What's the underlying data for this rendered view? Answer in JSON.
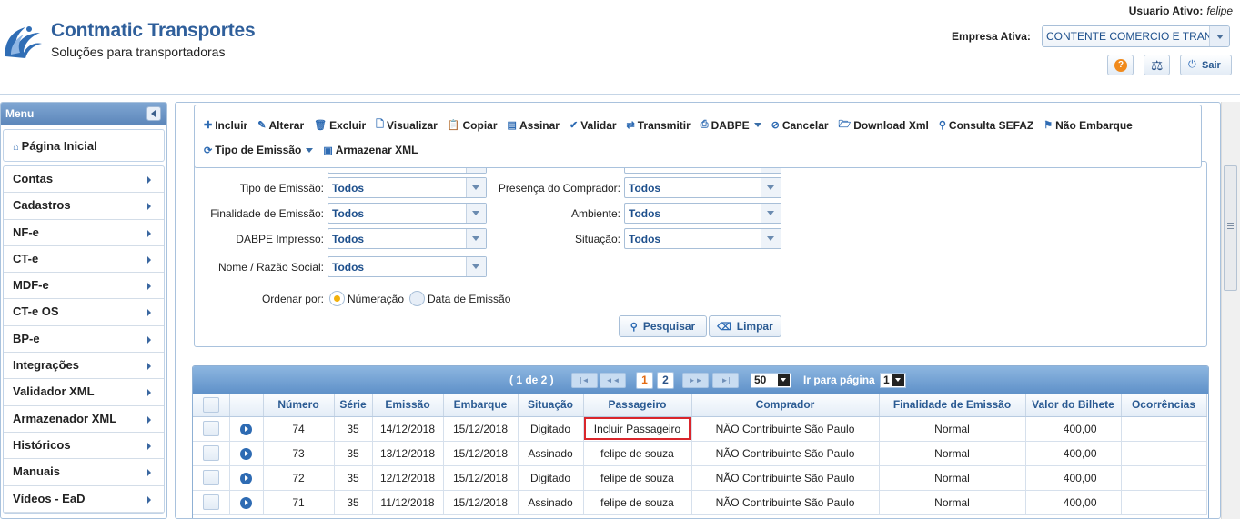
{
  "brand": {
    "title": "Contmatic Transportes",
    "subtitle": "Soluções para transportadoras"
  },
  "header": {
    "user_label": "Usuario Ativo:",
    "user_name": "felipe",
    "empresa_label": "Empresa Ativa:",
    "empresa_value": "CONTENTE COMERCIO E TRANSPORTES",
    "help_icon": "question-icon",
    "scale_icon": "scale-icon",
    "sair_label": "Sair"
  },
  "menu": {
    "title": "Menu",
    "home": "Página Inicial",
    "items": [
      "Contas",
      "Cadastros",
      "NF-e",
      "CT-e",
      "MDF-e",
      "CT-e OS",
      "BP-e",
      "Integrações",
      "Validador XML",
      "Armazenador XML",
      "Históricos",
      "Manuais",
      "Vídeos - EaD"
    ]
  },
  "toolbar": {
    "incluir": "Incluir",
    "alterar": "Alterar",
    "excluir": "Excluir",
    "visualizar": "Visualizar",
    "copiar": "Copiar",
    "assinar": "Assinar",
    "validar": "Validar",
    "transmitir": "Transmitir",
    "dabpe": "DABPE",
    "cancelar": "Cancelar",
    "download_xml": "Download Xml",
    "consulta_sefaz": "Consulta SEFAZ",
    "nao_embarque": "Não Embarque",
    "tipo_emissao": "Tipo de Emissão",
    "armazenar_xml": "Armazenar XML"
  },
  "filters": {
    "tipo_emissao": {
      "label": "Tipo de Emissão:",
      "value": "Todos"
    },
    "presenca_comprador": {
      "label": "Presença do Comprador:",
      "value": "Todos"
    },
    "finalidade_emissao": {
      "label": "Finalidade de Emissão:",
      "value": "Todos"
    },
    "ambiente": {
      "label": "Ambiente:",
      "value": "Todos"
    },
    "dabpe_impresso": {
      "label": "DABPE Impresso:",
      "value": "Todos"
    },
    "situacao": {
      "label": "Situação:",
      "value": "Todos"
    },
    "nome_razao": {
      "label": "Nome / Razão Social:",
      "value": "Todos"
    },
    "ordenar_label": "Ordenar por:",
    "ordenar_options": [
      "Númeração",
      "Data de Emissão"
    ],
    "pesquisar": "Pesquisar",
    "limpar": "Limpar"
  },
  "pager": {
    "info": "( 1 de 2 )",
    "first": "|◄",
    "prev": "◄◄",
    "next": "►►",
    "last": "►|",
    "pages": [
      "1",
      "2"
    ],
    "page_size": "50",
    "goto_label": "Ir para página",
    "goto_value": "1"
  },
  "grid": {
    "columns": [
      "Número",
      "Série",
      "Emissão",
      "Embarque",
      "Situação",
      "Passageiro",
      "Comprador",
      "Finalidade de Emissão",
      "Valor do Bilhete",
      "Ocorrências"
    ],
    "rows": [
      {
        "numero": "74",
        "serie": "35",
        "emissao": "14/12/2018",
        "embarque": "15/12/2018",
        "situacao": "Digitado",
        "passageiro": "Incluir Passageiro",
        "comprador": "NÃO Contribuinte São Paulo",
        "finalidade": "Normal",
        "valor": "400,00",
        "ocorrencias": ""
      },
      {
        "numero": "73",
        "serie": "35",
        "emissao": "13/12/2018",
        "embarque": "15/12/2018",
        "situacao": "Assinado",
        "passageiro": "felipe de souza",
        "comprador": "NÃO Contribuinte São Paulo",
        "finalidade": "Normal",
        "valor": "400,00",
        "ocorrencias": ""
      },
      {
        "numero": "72",
        "serie": "35",
        "emissao": "12/12/2018",
        "embarque": "15/12/2018",
        "situacao": "Digitado",
        "passageiro": "felipe de souza",
        "comprador": "NÃO Contribuinte São Paulo",
        "finalidade": "Normal",
        "valor": "400,00",
        "ocorrencias": ""
      },
      {
        "numero": "71",
        "serie": "35",
        "emissao": "11/12/2018",
        "embarque": "15/12/2018",
        "situacao": "Assinado",
        "passageiro": "felipe de souza",
        "comprador": "NÃO Contribuinte São Paulo",
        "finalidade": "Normal",
        "valor": "400,00",
        "ocorrencias": ""
      }
    ]
  },
  "colors": {
    "brand": "#2f5f9b",
    "accent": "#2e6bb3",
    "highlight": "#d9262c",
    "pager": "#5f91c9"
  }
}
